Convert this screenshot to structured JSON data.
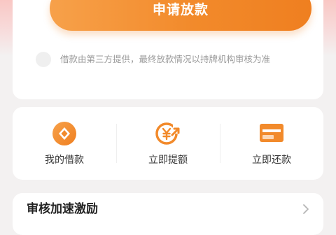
{
  "loan_card": {
    "apply_button": "申请放款",
    "disclaimer": "借款由第三方提供，最终放款情况以持牌机构审核为准"
  },
  "actions": [
    {
      "label": "我的借款",
      "icon": "coin-icon"
    },
    {
      "label": "立即提额",
      "icon": "yen-arrow-icon"
    },
    {
      "label": "立即还款",
      "icon": "card-icon"
    }
  ],
  "colors": {
    "accent": "#f28a2b",
    "accent_light": "#f7a14a"
  },
  "bottom_section": {
    "title": "审核加速激励"
  }
}
